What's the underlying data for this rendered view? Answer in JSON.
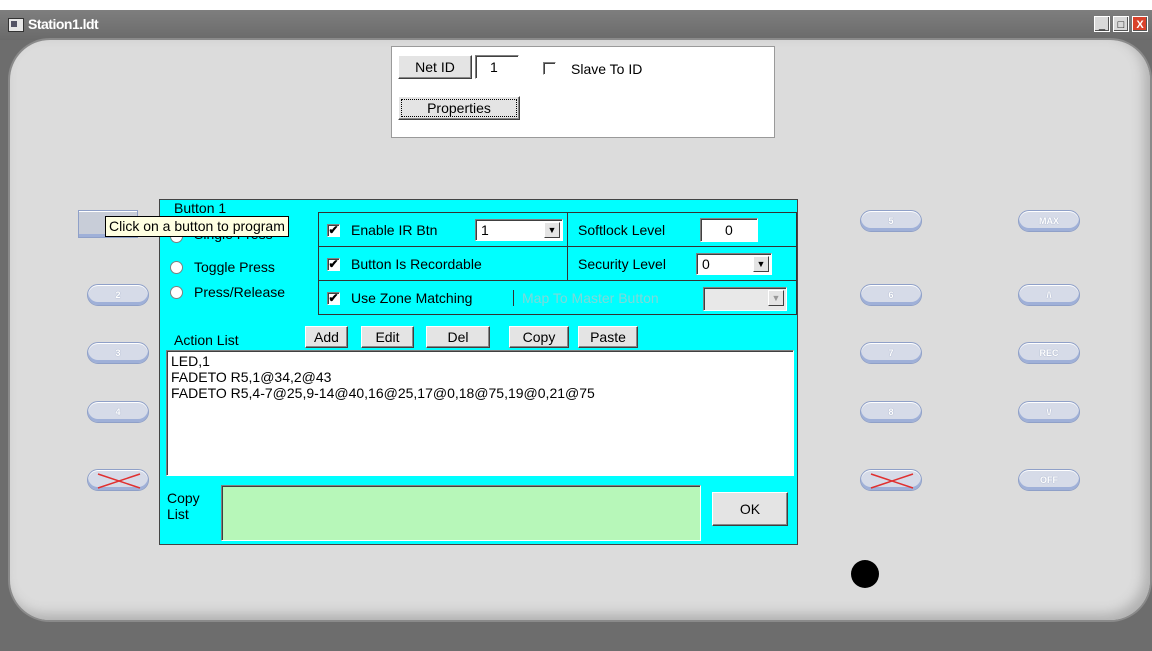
{
  "window": {
    "title": "Station1.ldt",
    "minimize": "_",
    "restore": "□",
    "close": "X"
  },
  "net": {
    "net_id_label": "Net ID",
    "net_id_value": "1",
    "slave_label": "Slave To ID",
    "properties_label": "Properties"
  },
  "tooltip": "Click on a button to program",
  "button_group": {
    "title": "Button 1",
    "options": [
      "Single Press",
      "Toggle Press",
      "Press/Release"
    ]
  },
  "ir": {
    "enable_label": "Enable IR Btn",
    "value": "1"
  },
  "softlock": {
    "label": "Softlock Level",
    "value": "0"
  },
  "recordable": {
    "label": "Button Is Recordable"
  },
  "security": {
    "label": "Security Level",
    "value": "0"
  },
  "zone": {
    "label": "Use Zone Matching"
  },
  "master": {
    "label": "Map To Master Button",
    "value": ""
  },
  "actions": {
    "label": "Action List",
    "buttons": [
      "Add",
      "Edit",
      "Del",
      "Copy",
      "Paste"
    ],
    "lines": [
      "LED,1",
      "FADETO R5,1@34,2@43",
      "FADETO R5,4-7@25,9-14@40,16@25,17@0,18@75,19@0,21@75"
    ]
  },
  "copy": {
    "label_line1": "Copy",
    "label_line2": "List",
    "ok_label": "OK"
  },
  "left_buttons": [
    "2",
    "3",
    "4"
  ],
  "mid_buttons": [
    "5",
    "6",
    "7",
    "8"
  ],
  "right_buttons": [
    "MAX",
    "/\\",
    "REC",
    "\\/",
    "OFF"
  ],
  "checkmark": "✔",
  "dropdown_arrow": "▼"
}
